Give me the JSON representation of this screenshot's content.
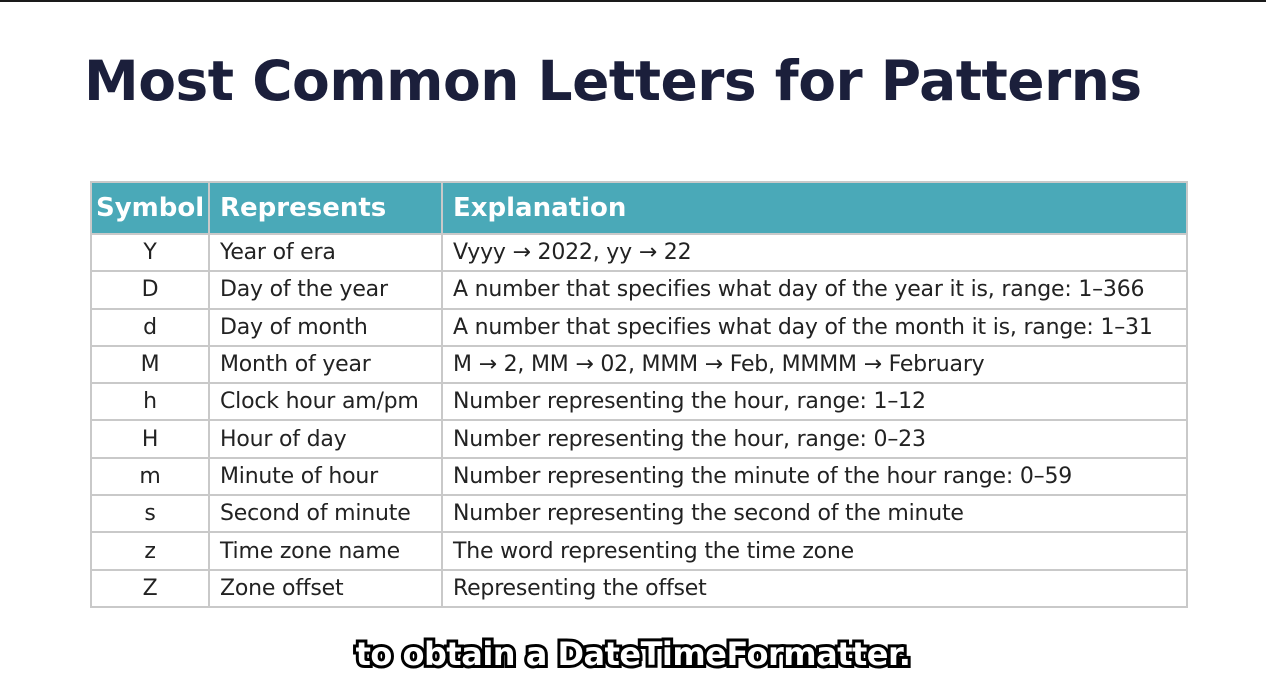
{
  "slide": {
    "title": "Most Common Letters for Patterns"
  },
  "table": {
    "headers": [
      "Symbol",
      "Represents",
      "Explanation"
    ],
    "rows": [
      {
        "symbol": "Y",
        "represents": "Year of era",
        "explanation": "Vyyy → 2022, yy → 22"
      },
      {
        "symbol": "D",
        "represents": "Day of the year",
        "explanation": "A number that specifies what day of the year it is, range: 1–366"
      },
      {
        "symbol": "d",
        "represents": "Day of month",
        "explanation": "A number that specifies what day of the month it is, range: 1–31"
      },
      {
        "symbol": "M",
        "represents": "Month of year",
        "explanation": "M → 2, MM → 02, MMM → Feb, MMMM → February"
      },
      {
        "symbol": "h",
        "represents": "Clock hour am/pm",
        "explanation": "Number representing the hour, range: 1–12"
      },
      {
        "symbol": "H",
        "represents": "Hour of day",
        "explanation": "Number representing the hour, range: 0–23"
      },
      {
        "symbol": "m",
        "represents": "Minute of hour",
        "explanation": "Number representing the minute of the hour range: 0–59"
      },
      {
        "symbol": "s",
        "represents": "Second of minute",
        "explanation": "Number representing the second of the minute"
      },
      {
        "symbol": "z",
        "represents": "Time zone name",
        "explanation": "The word representing the time zone"
      },
      {
        "symbol": "Z",
        "represents": "Zone offset",
        "explanation": "Representing the offset"
      }
    ]
  },
  "subtitle": {
    "text": "to obtain a DateTimeFormatter."
  },
  "colors": {
    "title": "#1b1f3b",
    "header_background": "#4aa9b8",
    "header_text": "#ffffff",
    "grid_border": "#c9c9c9",
    "cell_text": "#222222"
  }
}
